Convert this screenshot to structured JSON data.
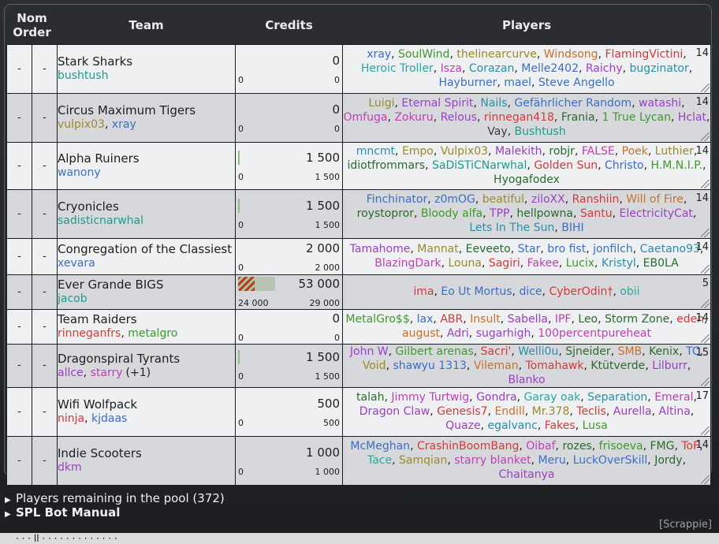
{
  "header": {
    "nom_order": "Nom Order",
    "team": "Team",
    "credits": "Credits",
    "players": "Players"
  },
  "teams": [
    {
      "nom": "-",
      "order": "-",
      "name": "Stark Sharks",
      "managers": [
        {
          "n": "bushtush",
          "c": "#1e9c8a"
        }
      ],
      "extra": "",
      "total": "0",
      "spent": "0",
      "remaining": "0",
      "bar": 0,
      "count": "14",
      "players": [
        {
          "n": "xray",
          "c": "#3b6fc6"
        },
        {
          "n": "SoulWind",
          "c": "#3e9a2c"
        },
        {
          "n": "thelinearcurve",
          "c": "#9a8a2a"
        },
        {
          "n": "Windsong",
          "c": "#c8712a"
        },
        {
          "n": "FlamingVictini",
          "c": "#d23a3a"
        },
        {
          "n": "Heroic Troller",
          "c": "#2aa8a0"
        },
        {
          "n": "Isza",
          "c": "#c03fb5"
        },
        {
          "n": "Corazan",
          "c": "#2a8fa8"
        },
        {
          "n": "Melle2402",
          "c": "#3b6fc6"
        },
        {
          "n": "Raichy",
          "c": "#9b3fc6"
        },
        {
          "n": "bugzinator",
          "c": "#2a8fa8"
        },
        {
          "n": "Hayburner",
          "c": "#3b6fc6"
        },
        {
          "n": "mael",
          "c": "#3b6fc6"
        },
        {
          "n": "Steve Angello",
          "c": "#3b6fc6"
        }
      ]
    },
    {
      "nom": "-",
      "order": "-",
      "name": "Circus Maximum Tigers",
      "managers": [
        {
          "n": "vulpix03",
          "c": "#9a8a2a"
        },
        {
          "n": "xray",
          "c": "#3b6fc6"
        }
      ],
      "extra": "",
      "total": "0",
      "spent": "0",
      "remaining": "0",
      "bar": 0,
      "count": "14",
      "players": [
        {
          "n": "Luigi",
          "c": "#9a8a2a"
        },
        {
          "n": "Eternal Spirit",
          "c": "#9b3fc6"
        },
        {
          "n": "Nails",
          "c": "#2a8fa8"
        },
        {
          "n": "Gefährlicher Random",
          "c": "#3b6fc6"
        },
        {
          "n": "watashi",
          "c": "#9b3fc6"
        },
        {
          "n": "Omfuga",
          "c": "#c03fb5"
        },
        {
          "n": "Zokuru",
          "c": "#c03fb5"
        },
        {
          "n": "Relous",
          "c": "#9b3fc6"
        },
        {
          "n": "rinnegan418",
          "c": "#d23a3a"
        },
        {
          "n": "Frania",
          "c": "#2a6a2a"
        },
        {
          "n": "1 True Lycan",
          "c": "#3e9a2c"
        },
        {
          "n": "Hclat",
          "c": "#9b3fc6"
        },
        {
          "n": "Vay",
          "c": "#3b3b3b"
        },
        {
          "n": "Bushtush",
          "c": "#1e9c8a"
        }
      ]
    },
    {
      "nom": "-",
      "order": "-",
      "name": "Alpha Ruiners",
      "managers": [
        {
          "n": "wanony",
          "c": "#3b6fc6"
        }
      ],
      "extra": "",
      "total": "1 500",
      "spent": "0",
      "remaining": "1 500",
      "bar": 0.01,
      "count": "14",
      "players": [
        {
          "n": "mncmt",
          "c": "#2a8fa8"
        },
        {
          "n": "Empo",
          "c": "#9a8a2a"
        },
        {
          "n": "Vulpix03",
          "c": "#9a8a2a"
        },
        {
          "n": "Malekith",
          "c": "#9b3fc6"
        },
        {
          "n": "robjr",
          "c": "#2a6a2a"
        },
        {
          "n": "FALSE",
          "c": "#c03fb5"
        },
        {
          "n": "Poek",
          "c": "#c8712a"
        },
        {
          "n": "Luthier",
          "c": "#9a8a2a"
        },
        {
          "n": "idiotfrommars",
          "c": "#2a6a2a"
        },
        {
          "n": "SaDiSTiCNarwhal",
          "c": "#1e9c8a"
        },
        {
          "n": "Golden Sun",
          "c": "#d23a3a"
        },
        {
          "n": "Christo",
          "c": "#3b6fc6"
        },
        {
          "n": "H.M.N.I.P.",
          "c": "#3e9a2c"
        },
        {
          "n": "Hyogafodex",
          "c": "#2a6a2a"
        }
      ]
    },
    {
      "nom": "-",
      "order": "-",
      "name": "Cryonicles",
      "managers": [
        {
          "n": "sadisticnarwhal",
          "c": "#1e9c8a"
        }
      ],
      "extra": "",
      "total": "1 500",
      "spent": "0",
      "remaining": "1 500",
      "bar": 0.01,
      "count": "14",
      "players": [
        {
          "n": "Finchinator",
          "c": "#3b6fc6"
        },
        {
          "n": "z0mOG",
          "c": "#3b6fc6"
        },
        {
          "n": "beatiful",
          "c": "#9a8a2a"
        },
        {
          "n": "ziloXX",
          "c": "#9b3fc6"
        },
        {
          "n": "Ranshiin",
          "c": "#d23a3a"
        },
        {
          "n": "Will of Fire",
          "c": "#c8712a"
        },
        {
          "n": "roystopror",
          "c": "#2a6a2a"
        },
        {
          "n": "Bloody alfa",
          "c": "#3e9a2c"
        },
        {
          "n": "TPP",
          "c": "#9b3fc6"
        },
        {
          "n": "hellpowna",
          "c": "#2a6a2a"
        },
        {
          "n": "Santu",
          "c": "#d23a3a"
        },
        {
          "n": "ElectricityCat",
          "c": "#9b3fc6"
        },
        {
          "n": "Lets In The Sun",
          "c": "#2a8fa8"
        },
        {
          "n": "BIHI",
          "c": "#3b6fc6"
        }
      ]
    },
    {
      "nom": "-",
      "order": "-",
      "name": "Congregation of the Classiest",
      "managers": [
        {
          "n": "xevara",
          "c": "#3b6fc6"
        }
      ],
      "extra": "",
      "total": "2 000",
      "spent": "0",
      "remaining": "2 000",
      "bar": 0,
      "count": "14",
      "players": [
        {
          "n": "Tamahome",
          "c": "#9b3fc6"
        },
        {
          "n": "Mannat",
          "c": "#9a8a2a"
        },
        {
          "n": "Eeveeto",
          "c": "#2a6a2a"
        },
        {
          "n": "Star",
          "c": "#3b6fc6"
        },
        {
          "n": "bro fist",
          "c": "#3b6fc6"
        },
        {
          "n": "jonfilch",
          "c": "#3b6fc6"
        },
        {
          "n": "Caetano93",
          "c": "#2a8fa8"
        },
        {
          "n": "BlazingDark",
          "c": "#c03fb5"
        },
        {
          "n": "Louna",
          "c": "#9a8a2a"
        },
        {
          "n": "Sagiri",
          "c": "#d23a3a"
        },
        {
          "n": "Fakee",
          "c": "#c03fb5"
        },
        {
          "n": "Lucix",
          "c": "#3e9a2c"
        },
        {
          "n": "Kristyl",
          "c": "#2a8fa8"
        },
        {
          "n": "EB0LA",
          "c": "#2a6a2a"
        }
      ]
    },
    {
      "nom": "-",
      "order": "-",
      "name": "Ever Grande BIGS",
      "managers": [
        {
          "n": "jacob",
          "c": "#1e9c8a"
        }
      ],
      "extra": "",
      "total": "53 000",
      "spent": "24 000",
      "remaining": "29 000",
      "bar": 0.45,
      "count": "5",
      "players": [
        {
          "n": "ima",
          "c": "#d23a3a"
        },
        {
          "n": "Eo Ut Mortus",
          "c": "#3b6fc6"
        },
        {
          "n": "dice",
          "c": "#3b6fc6"
        },
        {
          "n": "CyberOdin†",
          "c": "#d23a3a"
        },
        {
          "n": "obii",
          "c": "#2aa8a0"
        }
      ]
    },
    {
      "nom": "-",
      "order": "-",
      "name": "Team Raiders",
      "managers": [
        {
          "n": "rinneganfrs",
          "c": "#d23a3a"
        },
        {
          "n": "metalgro",
          "c": "#3e9a2c"
        }
      ],
      "extra": "",
      "total": "0",
      "spent": "0",
      "remaining": "0",
      "bar": 0,
      "count": "14",
      "players": [
        {
          "n": "MetalGro$$",
          "c": "#3e9a2c"
        },
        {
          "n": "lax",
          "c": "#3b6fc6"
        },
        {
          "n": "ABR",
          "c": "#d23a3a"
        },
        {
          "n": "Insult",
          "c": "#c8712a"
        },
        {
          "n": "Sabella",
          "c": "#9b3fc6"
        },
        {
          "n": "IPF",
          "c": "#c03fb5"
        },
        {
          "n": "Leo",
          "c": "#2a6a2a"
        },
        {
          "n": "Storm Zone",
          "c": "#2a6a2a"
        },
        {
          "n": "eden",
          "c": "#d23a3a"
        },
        {
          "n": "august",
          "c": "#c8712a"
        },
        {
          "n": "Adri",
          "c": "#9b3fc6"
        },
        {
          "n": "sugarhigh",
          "c": "#9b3fc6"
        },
        {
          "n": "100percentpureheat",
          "c": "#c03fb5"
        }
      ]
    },
    {
      "nom": "-",
      "order": "-",
      "name": "Dragonspiral Tyrants",
      "managers": [
        {
          "n": "allce",
          "c": "#9b3fc6"
        },
        {
          "n": "starry",
          "c": "#c03fb5"
        }
      ],
      "extra": "(+1)",
      "total": "1 500",
      "spent": "0",
      "remaining": "1 500",
      "bar": 0.01,
      "count": "15",
      "players": [
        {
          "n": "John W",
          "c": "#9b3fc6"
        },
        {
          "n": "Gilbert arenas",
          "c": "#3e9a2c"
        },
        {
          "n": "Sacri'",
          "c": "#d23a3a"
        },
        {
          "n": "Welli0u",
          "c": "#2a8fa8"
        },
        {
          "n": "Sjneider",
          "c": "#2a6a2a"
        },
        {
          "n": "SMB",
          "c": "#c8712a"
        },
        {
          "n": "Kenix",
          "c": "#2a6a2a"
        },
        {
          "n": "TC",
          "c": "#3b6fc6"
        },
        {
          "n": "Void",
          "c": "#9a8a2a"
        },
        {
          "n": "shawyu 1313",
          "c": "#3b6fc6"
        },
        {
          "n": "Vileman",
          "c": "#c8712a"
        },
        {
          "n": "Tomahawk",
          "c": "#d23a3a"
        },
        {
          "n": "Ktütverde",
          "c": "#2a6a2a"
        },
        {
          "n": "Lilburr",
          "c": "#9b3fc6"
        },
        {
          "n": "Blanko",
          "c": "#9b3fc6"
        }
      ]
    },
    {
      "nom": "-",
      "order": "-",
      "name": "Wifi Wolfpack",
      "managers": [
        {
          "n": "ninja",
          "c": "#d23a3a"
        },
        {
          "n": "kjdaas",
          "c": "#3b6fc6"
        }
      ],
      "extra": "",
      "total": "500",
      "spent": "0",
      "remaining": "500",
      "bar": 0,
      "count": "17",
      "players": [
        {
          "n": "talah",
          "c": "#2a6a2a"
        },
        {
          "n": "Jimmy Turtwig",
          "c": "#c03fb5"
        },
        {
          "n": "Gondra",
          "c": "#9b3fc6"
        },
        {
          "n": "Garay oak",
          "c": "#2aa8a0"
        },
        {
          "n": "Separation",
          "c": "#2a8fa8"
        },
        {
          "n": "Emeral",
          "c": "#c03fb5"
        },
        {
          "n": "Dragon Claw",
          "c": "#9b3fc6"
        },
        {
          "n": "Genesis7",
          "c": "#d23a3a"
        },
        {
          "n": "Endill",
          "c": "#c8712a"
        },
        {
          "n": "Mr.378",
          "c": "#9a8a2a"
        },
        {
          "n": "Teclis",
          "c": "#d23a3a"
        },
        {
          "n": "Aurella",
          "c": "#9b3fc6"
        },
        {
          "n": "Altina",
          "c": "#9b3fc6"
        },
        {
          "n": "Quaze",
          "c": "#9b3fc6"
        },
        {
          "n": "egalvanc",
          "c": "#2a8fa8"
        },
        {
          "n": "Fakes",
          "c": "#d23a3a"
        },
        {
          "n": "Lusa",
          "c": "#3e9a2c"
        }
      ]
    },
    {
      "nom": "-",
      "order": "-",
      "name": "Indie Scooters",
      "managers": [
        {
          "n": "dkm",
          "c": "#9b3fc6"
        }
      ],
      "extra": "",
      "total": "1 000",
      "spent": "0",
      "remaining": "1 000",
      "bar": 0,
      "count": "14",
      "players": [
        {
          "n": "McMeghan",
          "c": "#3b6fc6"
        },
        {
          "n": "CrashinBoomBang",
          "c": "#d23a3a"
        },
        {
          "n": "Oibaf",
          "c": "#c03fb5"
        },
        {
          "n": "rozes",
          "c": "#2a6a2a"
        },
        {
          "n": "frisoeva",
          "c": "#3e9a2c"
        },
        {
          "n": "FMG",
          "c": "#2a6a2a"
        },
        {
          "n": "ToF",
          "c": "#d23a3a"
        },
        {
          "n": "Tace",
          "c": "#2aa8a0"
        },
        {
          "n": "Samqian",
          "c": "#9a8a2a"
        },
        {
          "n": "starry blanket",
          "c": "#c03fb5"
        },
        {
          "n": "Meru",
          "c": "#3b6fc6"
        },
        {
          "n": "LuckOverSkill",
          "c": "#3b6fc6"
        },
        {
          "n": "Jordy",
          "c": "#2a6a2a"
        },
        {
          "n": "Chaitanya",
          "c": "#9b3fc6"
        }
      ]
    }
  ],
  "pool": "Players remaining in the pool (372)",
  "manual": "SPL Bot Manual",
  "footer": "[Scrappie]",
  "under_text": "· · · ll   · · ·       ·              ·           · · ·          ·   · ·     · ·"
}
